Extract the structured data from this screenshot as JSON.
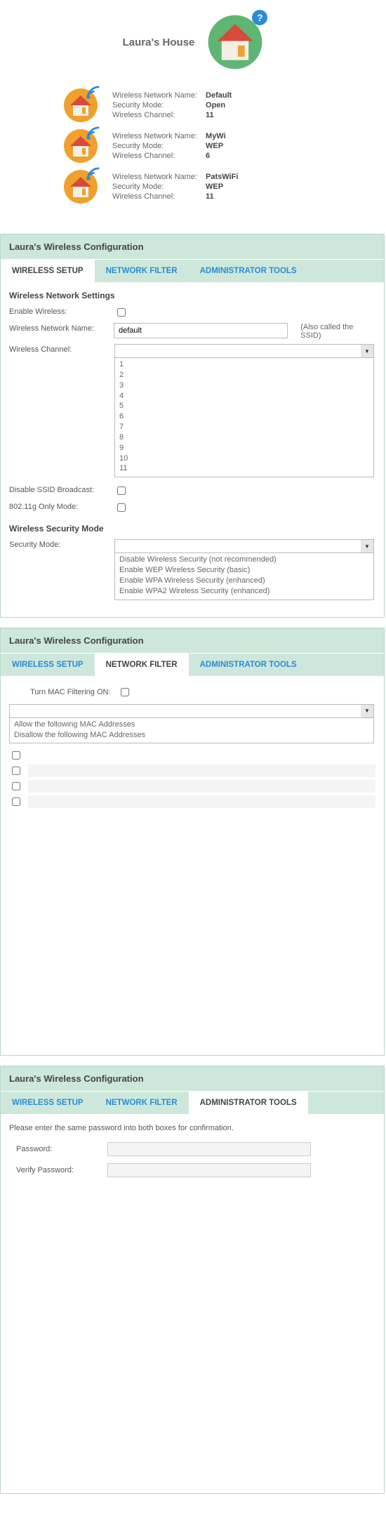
{
  "header": {
    "title": "Laura's House",
    "help_icon": "?"
  },
  "networks": [
    {
      "name_label": "Wireless Network Name:",
      "name": "Default",
      "sec_label": "Security Mode:",
      "sec": "Open",
      "ch_label": "Wireless Channel:",
      "ch": "11"
    },
    {
      "name_label": "Wireless Network Name:",
      "name": "MyWi",
      "sec_label": "Security Mode:",
      "sec": "WEP",
      "ch_label": "Wireless Channel:",
      "ch": "6"
    },
    {
      "name_label": "Wireless Network Name:",
      "name": "PatsWiFi",
      "sec_label": "Security Mode:",
      "sec": "WEP",
      "ch_label": "Wireless Channel:",
      "ch": "11"
    }
  ],
  "panel_title": "Laura's Wireless Configuration",
  "tabs": {
    "setup": "WIRELESS SETUP",
    "filter": "NETWORK FILTER",
    "admin": "ADMINISTRATOR TOOLS"
  },
  "wireless_setup": {
    "section1_title": "Wireless Network Settings",
    "enable_label": "Enable Wireless:",
    "name_label": "Wireless Network Name:",
    "name_value": "default",
    "name_hint": "(Also called the SSID)",
    "channel_label": "Wireless Channel:",
    "channel_options": [
      "1",
      "2",
      "3",
      "4",
      "5",
      "6",
      "7",
      "8",
      "9",
      "10",
      "11"
    ],
    "ssid_label": "Disable SSID Broadcast:",
    "gmode_label": "802.11g Only Mode:",
    "section2_title": "Wireless Security Mode",
    "sec_label": "Security Mode:",
    "sec_options": [
      "Disable Wireless Security (not recommended)",
      "Enable WEP Wireless Security (basic)",
      "Enable WPA Wireless Security (enhanced)",
      "Enable WPA2 Wireless Security (enhanced)"
    ]
  },
  "network_filter": {
    "toggle_label": "Turn MAC Filtering ON:",
    "options": [
      "Allow the following MAC Addresses",
      "Disallow the following MAC Addresses"
    ]
  },
  "admin": {
    "instruction": "Please enter the same password into both boxes for confirmation.",
    "password_label": "Password:",
    "verify_label": "Verify Password:"
  }
}
